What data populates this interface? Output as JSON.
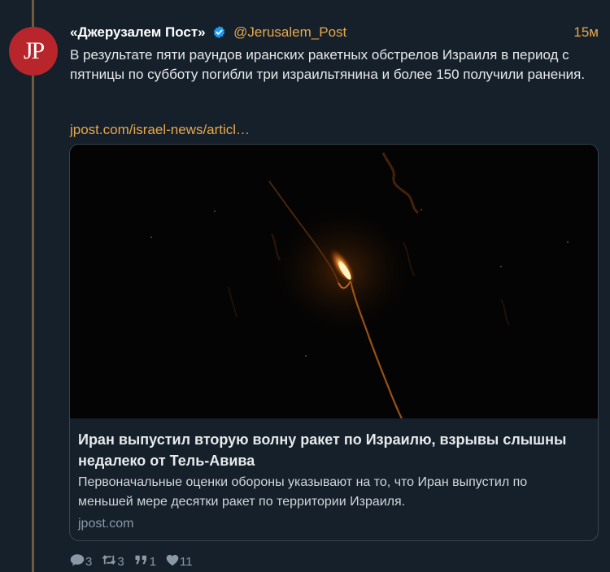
{
  "tweet": {
    "avatar_text": "JP",
    "display_name": "«Джерузалем Пост»",
    "handle": "@Jerusalem_Post",
    "time": "15м",
    "text": "В результате пяти раундов иранских ракетных обстрелов Израиля в период с пятницы по субботу погибли три израильтянина и более 150 получили ранения.",
    "link": "jpost.com/israel-news/articl…"
  },
  "card": {
    "title": "Иран выпустил вторую волну ракет по Израилю, взрывы слышны недалеко от Тель-Авива",
    "description": "Первоначальные оценки обороны указывают на то, что Иран выпустил по меньшей мере десятки ракет по территории Израиля.",
    "domain": "jpost.com"
  },
  "actions": {
    "replies": "3",
    "retweets": "3",
    "quotes": "1",
    "likes": "11"
  },
  "icons": [
    "verified-badge-icon",
    "reply-icon",
    "retweet-icon",
    "quote-icon",
    "heart-icon"
  ],
  "colors": {
    "background": "#15202b",
    "accent": "#e8a84a",
    "avatar": "#b8252b",
    "verified": "#1d9bf0"
  }
}
